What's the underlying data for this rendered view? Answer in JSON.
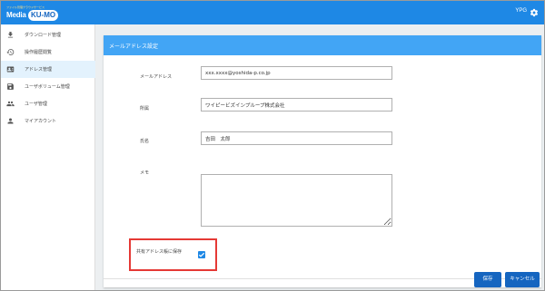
{
  "header": {
    "logo_tagline": "ファイル管理クラウドサービス",
    "logo_media": "Media",
    "logo_kumo": "KU-MO",
    "user": "YPG"
  },
  "sidebar": {
    "items": [
      {
        "label": "ダウンロード管理",
        "icon": "download-icon",
        "active": false
      },
      {
        "label": "操作履歴閲覧",
        "icon": "history-icon",
        "active": false
      },
      {
        "label": "アドレス管理",
        "icon": "contact-card-icon",
        "active": true
      },
      {
        "label": "ユーザボリューム管理",
        "icon": "save-icon",
        "active": false
      },
      {
        "label": "ユーザ管理",
        "icon": "people-icon",
        "active": false
      },
      {
        "label": "マイアカウント",
        "icon": "person-icon",
        "active": false
      }
    ]
  },
  "form": {
    "title": "メールアドレス設定",
    "email_label": "メールアドレス",
    "email_value": "xxx.xxxx@yoshida-p.co.jp",
    "affiliation_label": "所属",
    "affiliation_value": "ワイピービズインプループ株式会社",
    "name_label": "氏名",
    "name_value": "吉田　太郎",
    "memo_label": "メモ",
    "memo_value": "",
    "shared_label": "共有アドレス帳に保存",
    "shared_checked": true
  },
  "actions": {
    "save_label": "保存",
    "cancel_label": "キャンセル"
  },
  "colors": {
    "topbar": "#1e88e5",
    "card_header": "#42a5f5",
    "button": "#1565c0",
    "highlight": "#e53935"
  }
}
